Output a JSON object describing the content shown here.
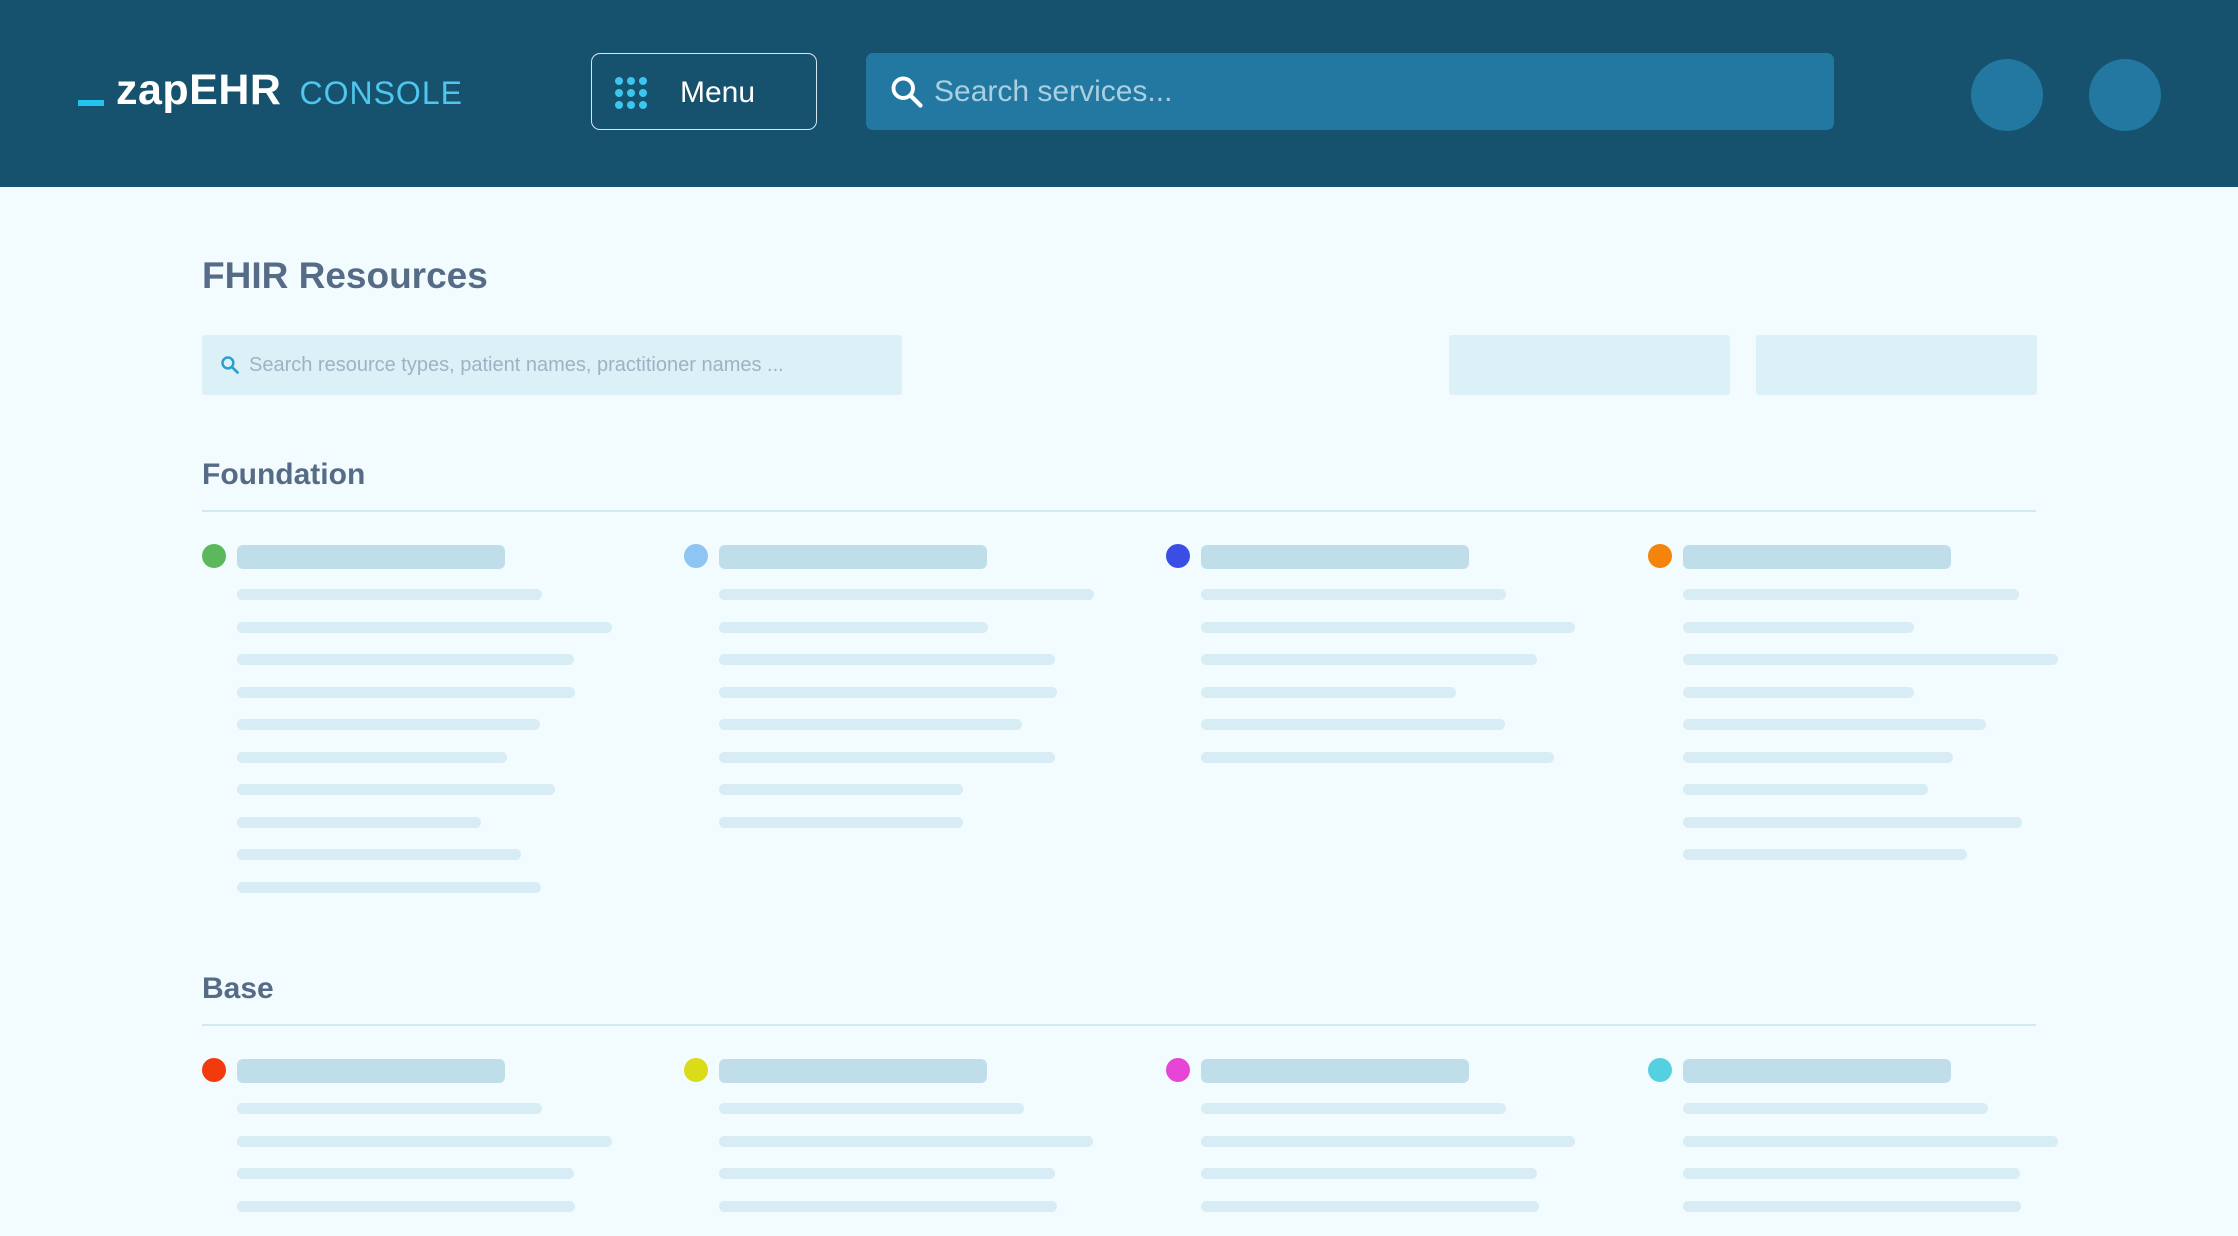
{
  "header": {
    "logo_main": "zapEHR",
    "logo_sub": "CONSOLE",
    "menu_label": "Menu",
    "search_placeholder": "Search services..."
  },
  "page": {
    "title": "FHIR Resources",
    "filter_placeholder": "Search resource types, patient names, practitioner names ..."
  },
  "sections": [
    {
      "title": "Foundation",
      "dot_colors": [
        "#5cb85c",
        "#8ec5f2",
        "#3a4ee6",
        "#f5840c"
      ]
    },
    {
      "title": "Base",
      "dot_colors": [
        "#f23a0c",
        "#dadc18",
        "#e645d6",
        "#55d0e0"
      ]
    }
  ],
  "icons": {
    "menu": "grid-dots-icon",
    "search": "search-icon"
  }
}
